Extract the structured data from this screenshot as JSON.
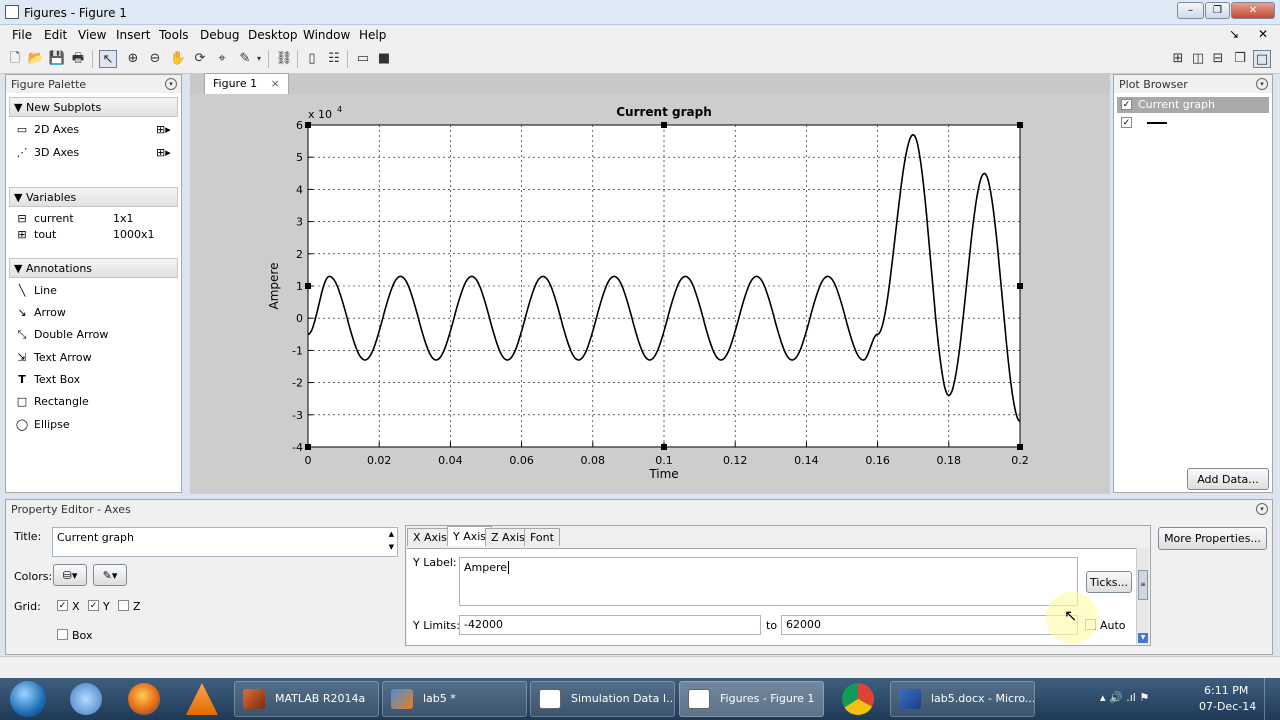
{
  "window": {
    "title": "Figures - Figure 1",
    "minimize": "–",
    "restore": "❐",
    "close": "✕"
  },
  "menu": [
    "File",
    "Edit",
    "View",
    "Insert",
    "Tools",
    "Debug",
    "Desktop",
    "Window",
    "Help"
  ],
  "figure_palette": {
    "title": "Figure Palette",
    "new_subplots": {
      "header": "New Subplots",
      "items": [
        "2D Axes",
        "3D Axes"
      ]
    },
    "variables": {
      "header": "Variables",
      "items": [
        {
          "name": "current",
          "size": "1x1"
        },
        {
          "name": "tout",
          "size": "1000x1"
        }
      ]
    },
    "annotations": {
      "header": "Annotations",
      "items": [
        "Line",
        "Arrow",
        "Double Arrow",
        "Text Arrow",
        "Text Box",
        "Rectangle",
        "Ellipse"
      ]
    }
  },
  "figure_tab": {
    "label": "Figure 1",
    "close": "×"
  },
  "plot_browser": {
    "title": "Plot Browser",
    "entries": [
      "Current graph"
    ],
    "add_data": "Add Data..."
  },
  "chart_data": {
    "type": "line",
    "title": "Current graph",
    "xlabel": "Time",
    "ylabel": "Ampere",
    "y_multiplier": "x 10",
    "y_multiplier_exp": "4",
    "xlim": [
      0,
      0.2
    ],
    "ylim": [
      -4,
      6
    ],
    "x_ticks": [
      "0",
      "0.02",
      "0.04",
      "0.06",
      "0.08",
      "0.1",
      "0.12",
      "0.14",
      "0.16",
      "0.18",
      "0.2"
    ],
    "y_ticks": [
      "6",
      "5",
      "4",
      "3",
      "2",
      "1",
      "0",
      "-1",
      "-2",
      "-3",
      "-4"
    ],
    "grid": true,
    "series": [
      {
        "color": "#000000",
        "x": [
          0,
          0.006,
          0.016,
          0.026,
          0.036,
          0.046,
          0.056,
          0.066,
          0.076,
          0.086,
          0.096,
          0.106,
          0.116,
          0.126,
          0.136,
          0.146,
          0.156,
          0.16,
          0.17,
          0.18,
          0.19,
          0.2
        ],
        "y": [
          -0.5,
          1.3,
          -1.3,
          1.3,
          -1.3,
          1.3,
          -1.3,
          1.3,
          -1.3,
          1.3,
          -1.3,
          1.3,
          -1.3,
          1.3,
          -1.3,
          1.3,
          -1.3,
          -0.5,
          5.7,
          -2.4,
          4.5,
          -3.2
        ]
      }
    ]
  },
  "property_editor": {
    "title": "Property Editor - Axes",
    "title_label": "Title:",
    "title_value": "Current graph",
    "colors_label": "Colors:",
    "grid_label": "Grid:",
    "grid_x": "X",
    "grid_y": "Y",
    "grid_z": "Z",
    "box_label": "Box",
    "tabs": [
      "X Axis",
      "Y Axis",
      "Z Axis",
      "Font"
    ],
    "ylabel_label": "Y Label:",
    "ylabel_value": "Ampere",
    "ticks_button": "Ticks...",
    "ylimits_label": "Y Limits:",
    "ylim_from": "-42000",
    "to_label": "to",
    "ylim_to": "62000",
    "auto_label": "Auto",
    "more_properties": "More Properties..."
  },
  "taskbar": {
    "tasks": [
      "MATLAB R2014a",
      "lab5 *",
      "Simulation Data I...",
      "Figures - Figure 1",
      "lab5.docx - Micro..."
    ],
    "time": "6:11 PM",
    "date": "07-Dec-14",
    "tray": "▴  🔊  .ıl  ⚑"
  }
}
